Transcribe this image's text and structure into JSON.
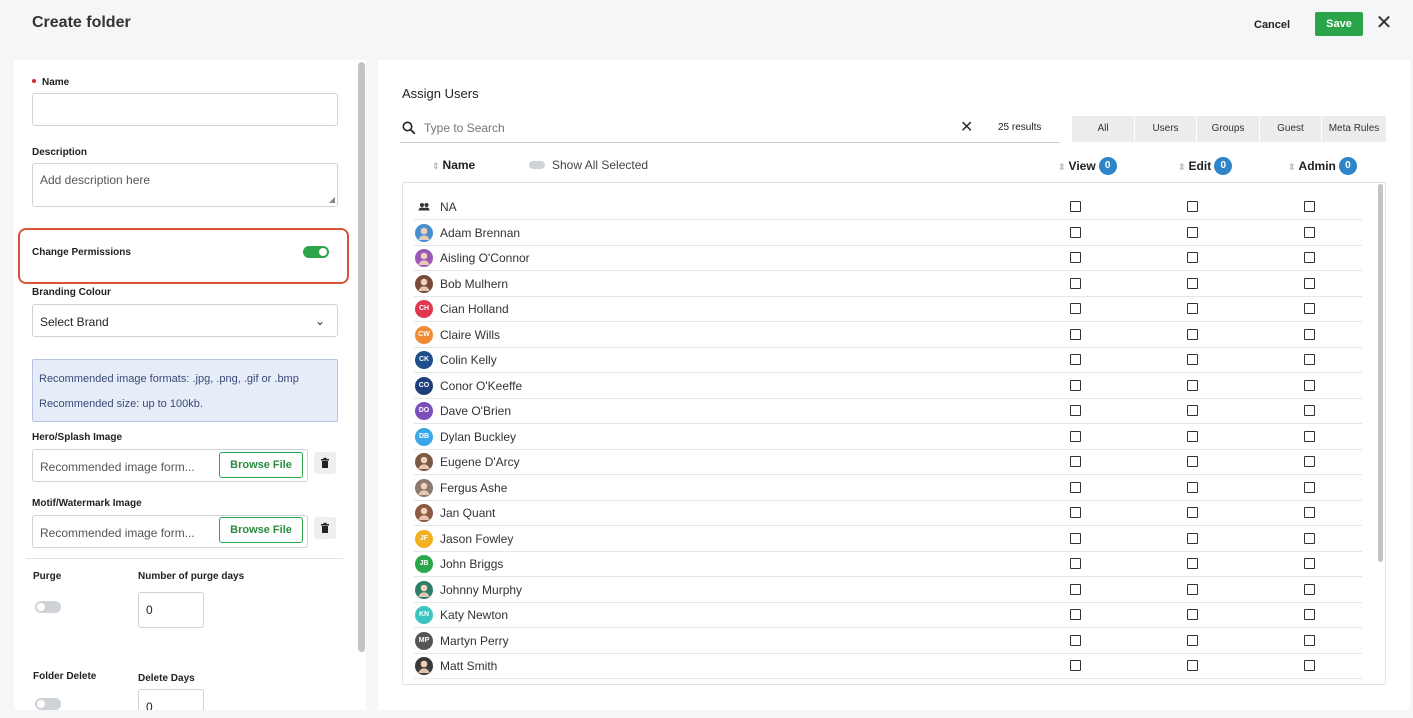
{
  "header": {
    "title": "Create folder",
    "cancel_label": "Cancel",
    "save_label": "Save",
    "close_glyph": "✕"
  },
  "form": {
    "name_label": "Name",
    "name_value": "",
    "description_label": "Description",
    "description_placeholder": "Add description here",
    "change_permissions_label": "Change Permissions",
    "change_permissions_on": true,
    "branding_label": "Branding Colour",
    "branding_value": "Select Brand",
    "info_line1": "Recommended image formats: .jpg, .png, .gif or .bmp",
    "info_line2": "Recommended size: up to 100kb.",
    "hero_label": "Hero/Splash Image",
    "hero_placeholder": "Recommended image form...",
    "motif_label": "Motif/Watermark Image",
    "motif_placeholder": "Recommended image form...",
    "browse_label": "Browse File",
    "purge_label": "Purge",
    "purge_days_label": "Number of purge days",
    "purge_days_value": "0",
    "folder_delete_label": "Folder Delete",
    "delete_days_label": "Delete Days",
    "delete_days_value": "0"
  },
  "assign": {
    "title": "Assign Users",
    "search_placeholder": "Type to Search",
    "results": "25 results",
    "tabs": [
      "All",
      "Users",
      "Groups",
      "Guest",
      "Meta Rules"
    ],
    "columns": {
      "name": "Name",
      "view": "View",
      "edit": "Edit",
      "admin": "Admin"
    },
    "counts": {
      "view": "0",
      "edit": "0",
      "admin": "0"
    },
    "show_all_selected": "Show All Selected"
  },
  "colors": {
    "accent": "#2ca44a",
    "highlight": "#d9533b",
    "badge": "#2e86c8"
  },
  "users": [
    {
      "name": "NA",
      "initials": "",
      "color": "#ffffff",
      "icon": "group-icon"
    },
    {
      "name": "Adam Brennan",
      "initials": "",
      "color": "#4a8fd0",
      "icon": "photo-avatar"
    },
    {
      "name": "Aisling O'Connor",
      "initials": "",
      "color": "#9b59b6",
      "icon": "photo-avatar"
    },
    {
      "name": "Bob Mulhern",
      "initials": "",
      "color": "#7a4b3a",
      "icon": "photo-avatar"
    },
    {
      "name": "Cian Holland",
      "initials": "CH",
      "color": "#e0364f",
      "icon": ""
    },
    {
      "name": "Claire Wills",
      "initials": "CW",
      "color": "#f08a33",
      "icon": ""
    },
    {
      "name": "Colin Kelly",
      "initials": "CK",
      "color": "#1f4e8c",
      "icon": ""
    },
    {
      "name": "Conor O'Keeffe",
      "initials": "CO",
      "color": "#1f3f7a",
      "icon": ""
    },
    {
      "name": "Dave O'Brien",
      "initials": "DO",
      "color": "#7c4fb8",
      "icon": ""
    },
    {
      "name": "Dylan Buckley",
      "initials": "DB",
      "color": "#3aa7e8",
      "icon": ""
    },
    {
      "name": "Eugene D'Arcy",
      "initials": "",
      "color": "#7a5a45",
      "icon": "photo-avatar"
    },
    {
      "name": "Fergus Ashe",
      "initials": "",
      "color": "#8b7a70",
      "icon": "photo-avatar"
    },
    {
      "name": "Jan Quant",
      "initials": "",
      "color": "#8a5a45",
      "icon": "photo-avatar"
    },
    {
      "name": "Jason Fowley",
      "initials": "JF",
      "color": "#f2b01e",
      "icon": ""
    },
    {
      "name": "John Briggs",
      "initials": "JB",
      "color": "#2ca44a",
      "icon": ""
    },
    {
      "name": "Johnny Murphy",
      "initials": "",
      "color": "#2e7d6b",
      "icon": "photo-avatar"
    },
    {
      "name": "Katy Newton",
      "initials": "KN",
      "color": "#3cc4c0",
      "icon": ""
    },
    {
      "name": "Martyn Perry",
      "initials": "MP",
      "color": "#555555",
      "icon": ""
    },
    {
      "name": "Matt Smith",
      "initials": "",
      "color": "#3a3a3a",
      "icon": "photo-avatar"
    }
  ]
}
